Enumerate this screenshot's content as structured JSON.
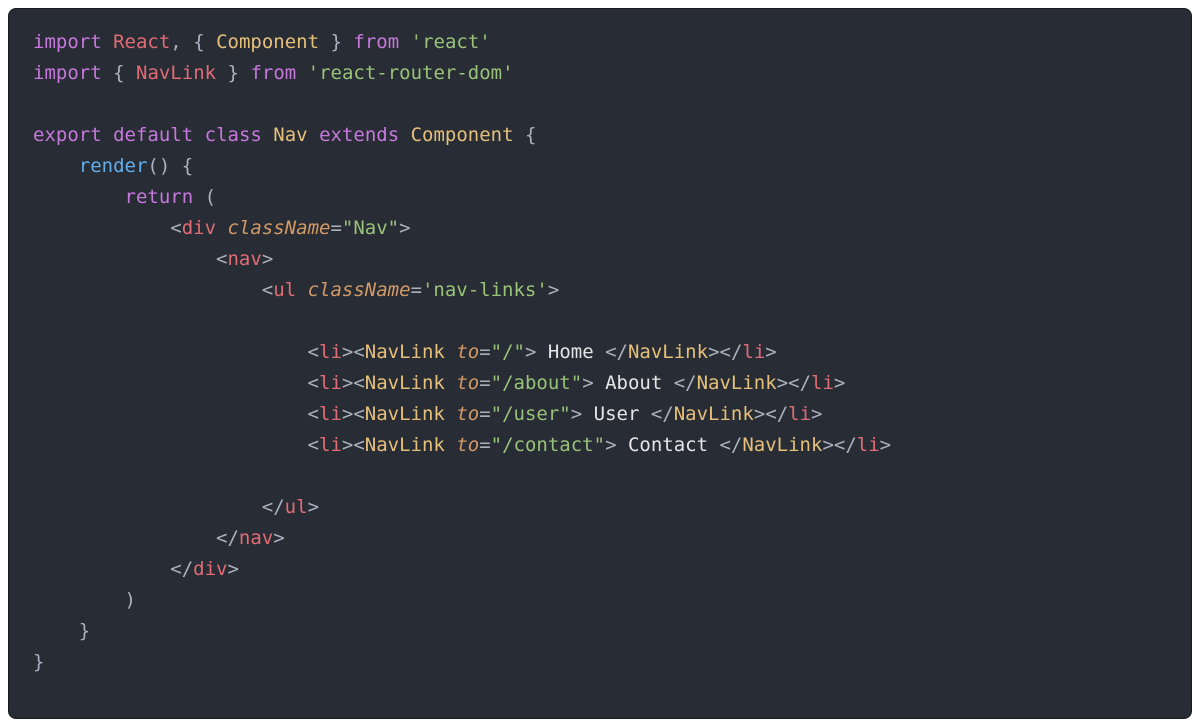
{
  "line1": {
    "import": "import",
    "React": "React",
    "comma": ",",
    "lbrace": "{",
    "Component": "Component",
    "rbrace": "}",
    "from": "from",
    "mod": "'react'"
  },
  "line2": {
    "import": "import",
    "lbrace": "{",
    "NavLink": "NavLink",
    "rbrace": "}",
    "from": "from",
    "mod": "'react-router-dom'"
  },
  "line4": {
    "export": "export",
    "default": "default",
    "class": "class",
    "Nav": "Nav",
    "extends": "extends",
    "Component": "Component",
    "lbrace": "{"
  },
  "line5": {
    "render": "render",
    "parens": "()",
    "lbrace": "{"
  },
  "line6": {
    "return": "return",
    "lparen": "("
  },
  "line7": {
    "lt": "<",
    "tag": "div",
    "attr": "className",
    "eq": "=",
    "val": "\"Nav\"",
    "gt": ">"
  },
  "line8": {
    "lt": "<",
    "tag": "nav",
    "gt": ">"
  },
  "line9": {
    "lt": "<",
    "tag": "ul",
    "attr": "className",
    "eq": "=",
    "val": "'nav-links'",
    "gt": ">"
  },
  "li1": {
    "lt1": "<",
    "li": "li",
    "gt1": ">",
    "lt2": "<",
    "navlink": "NavLink",
    "attr": "to",
    "eq": "=",
    "val": "\"/\"",
    "gt2": ">",
    "text": " Home ",
    "lt3": "</",
    "navlink2": "NavLink",
    "gt3": ">",
    "lt4": "</",
    "li2": "li",
    "gt4": ">"
  },
  "li2": {
    "lt1": "<",
    "li": "li",
    "gt1": ">",
    "lt2": "<",
    "navlink": "NavLink",
    "attr": "to",
    "eq": "=",
    "val": "\"/about\"",
    "gt2": ">",
    "text": " About ",
    "lt3": "</",
    "navlink2": "NavLink",
    "gt3": ">",
    "lt4": "</",
    "li2": "li",
    "gt4": ">"
  },
  "li3": {
    "lt1": "<",
    "li": "li",
    "gt1": ">",
    "lt2": "<",
    "navlink": "NavLink",
    "attr": "to",
    "eq": "=",
    "val": "\"/user\"",
    "gt2": ">",
    "text": " User ",
    "lt3": "</",
    "navlink2": "NavLink",
    "gt3": ">",
    "lt4": "</",
    "li2": "li",
    "gt4": ">"
  },
  "li4": {
    "lt1": "<",
    "li": "li",
    "gt1": ">",
    "lt2": "<",
    "navlink": "NavLink",
    "attr": "to",
    "eq": "=",
    "val": "\"/contact\"",
    "gt2": ">",
    "text": " Contact ",
    "lt3": "</",
    "navlink2": "NavLink",
    "gt3": ">",
    "lt4": "</",
    "li2": "li",
    "gt4": ">"
  },
  "close_ul": {
    "lt": "</",
    "tag": "ul",
    "gt": ">"
  },
  "close_nav": {
    "lt": "</",
    "tag": "nav",
    "gt": ">"
  },
  "close_div": {
    "lt": "</",
    "tag": "div",
    "gt": ">"
  },
  "close_paren": ")",
  "close_brace1": "}",
  "close_brace2": "}"
}
